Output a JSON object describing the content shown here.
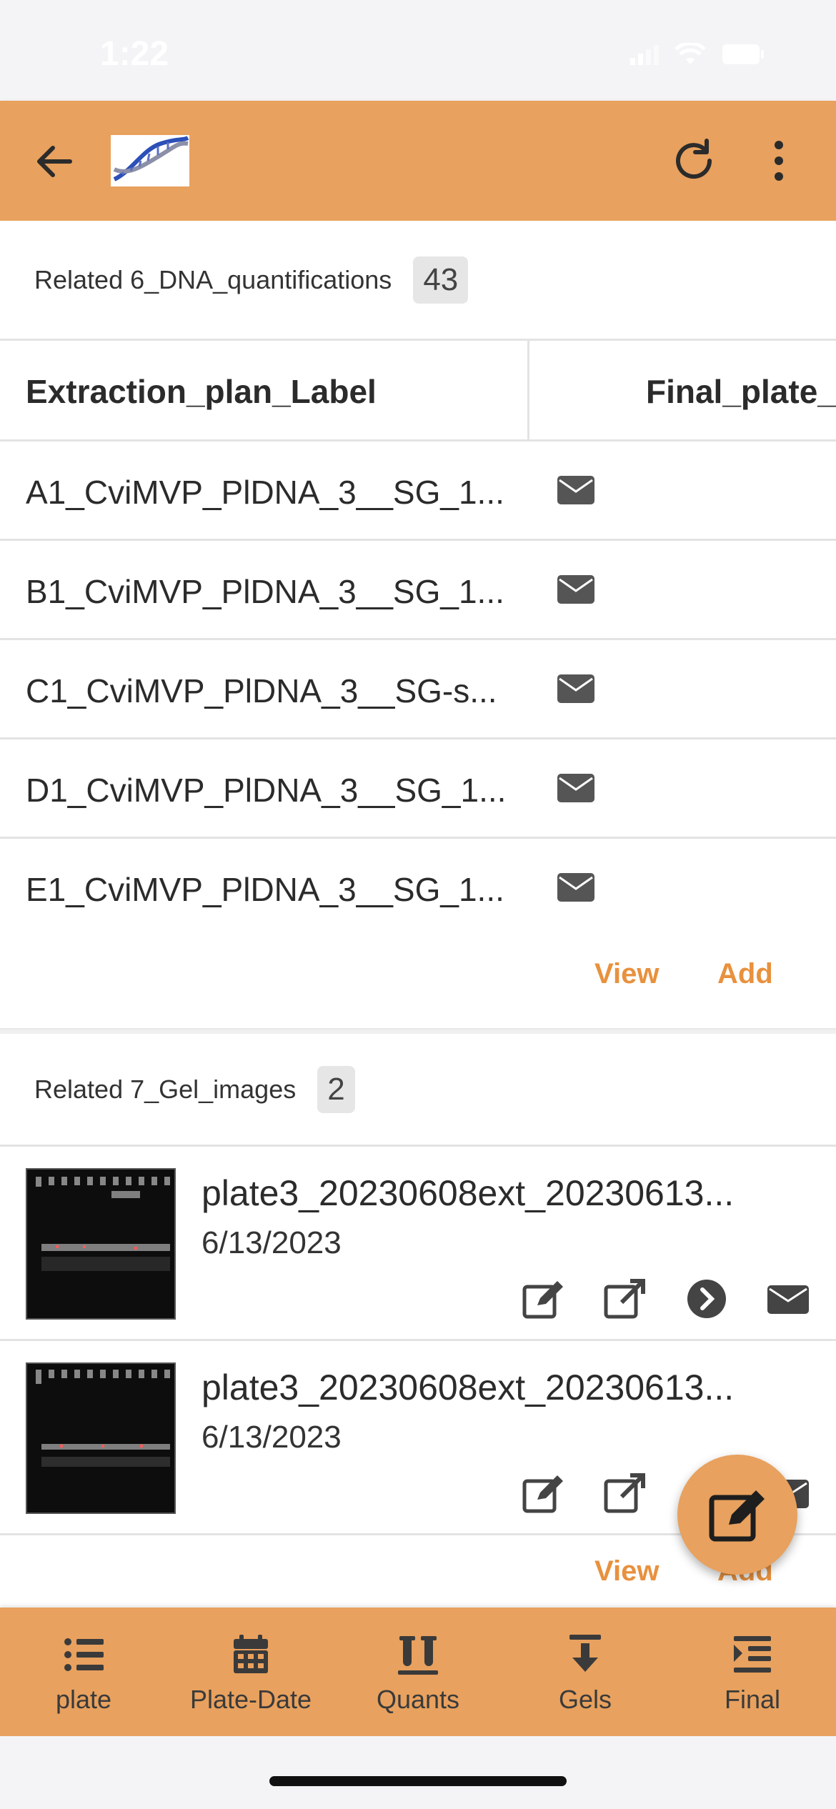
{
  "status_bar": {
    "time": "1:22"
  },
  "app_bar": {
    "logo_icon": "dna-helix-logo",
    "accent_color": "#e8a15e"
  },
  "quantifications": {
    "title": "Related 6_DNA_quantifications",
    "count": "43",
    "columns": [
      "Extraction_plan_Label",
      "Final_plate_"
    ],
    "rows": [
      {
        "label": "A1_CviMVP_PlDNA_3__SG_1..."
      },
      {
        "label": "B1_CviMVP_PlDNA_3__SG_1..."
      },
      {
        "label": "C1_CviMVP_PlDNA_3__SG-s..."
      },
      {
        "label": "D1_CviMVP_PlDNA_3__SG_1..."
      },
      {
        "label": "E1_CviMVP_PlDNA_3__SG_1..."
      }
    ],
    "view_label": "View",
    "add_label": "Add"
  },
  "gel_images": {
    "title": "Related 7_Gel_images",
    "count": "2",
    "items": [
      {
        "title": "plate3_20230608ext_20230613...",
        "date": "6/13/2023"
      },
      {
        "title": "plate3_20230608ext_20230613...",
        "date": "6/13/2023"
      }
    ],
    "view_label": "View",
    "add_label": "Add"
  },
  "tabs": [
    {
      "label": "plate",
      "icon": "list-icon"
    },
    {
      "label": "Plate-Date",
      "icon": "calendar-icon"
    },
    {
      "label": "Quants",
      "icon": "test-tubes-icon"
    },
    {
      "label": "Gels",
      "icon": "download-arrow-icon"
    },
    {
      "label": "Final",
      "icon": "indent-list-icon"
    }
  ]
}
